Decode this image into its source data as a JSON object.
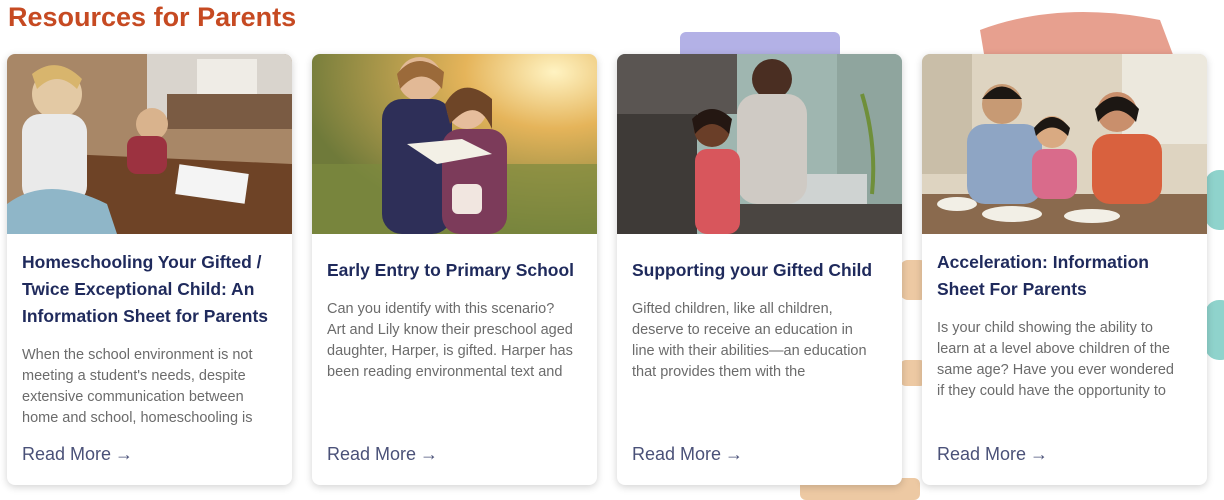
{
  "section": {
    "title": "Resources for Parents"
  },
  "cards": [
    {
      "title_lines": [
        "Homeschooling Your Gifted /",
        "Twice Exceptional Child: An",
        "Information Sheet for Parents"
      ],
      "excerpt_lines": [
        "When the school environment is not",
        "meeting a student's needs, despite",
        "extensive communication between",
        "home and school, homeschooling is"
      ],
      "read_more": "Read More",
      "image": "photo: two boys doing schoolwork at a wooden dining table"
    },
    {
      "title_lines": [
        "Early Entry to Primary School"
      ],
      "excerpt_lines": [
        "Can you identify with this scenario?",
        "Art and Lily know their preschool aged",
        "daughter, Harper, is gifted. Harper has",
        "been reading environmental text and"
      ],
      "read_more": "Read More",
      "image": "photo: two young girls reading a book outdoors in sunlight"
    },
    {
      "title_lines": [
        "Supporting your Gifted Child"
      ],
      "excerpt_lines": [
        "Gifted children, like all children,",
        "deserve to receive an education in",
        "line with their abilities—an education",
        "that provides them with the"
      ],
      "read_more": "Read More",
      "image": "photo: father and daughter at a kitchen sink"
    },
    {
      "title_lines": [
        "Acceleration: Information",
        "Sheet For Parents"
      ],
      "excerpt_lines": [
        "Is your child showing the ability to",
        "learn at a level above children of the",
        "same age? Have you ever wondered",
        "if they could have the opportunity to"
      ],
      "read_more": "Read More",
      "image": "photo: family sharing a meal at a dining table"
    }
  ],
  "arrow": "→",
  "colors": {
    "heading": "#c64a22",
    "card_title": "#1f2a5c",
    "excerpt": "#6b6b6b",
    "link": "#4a5178"
  }
}
